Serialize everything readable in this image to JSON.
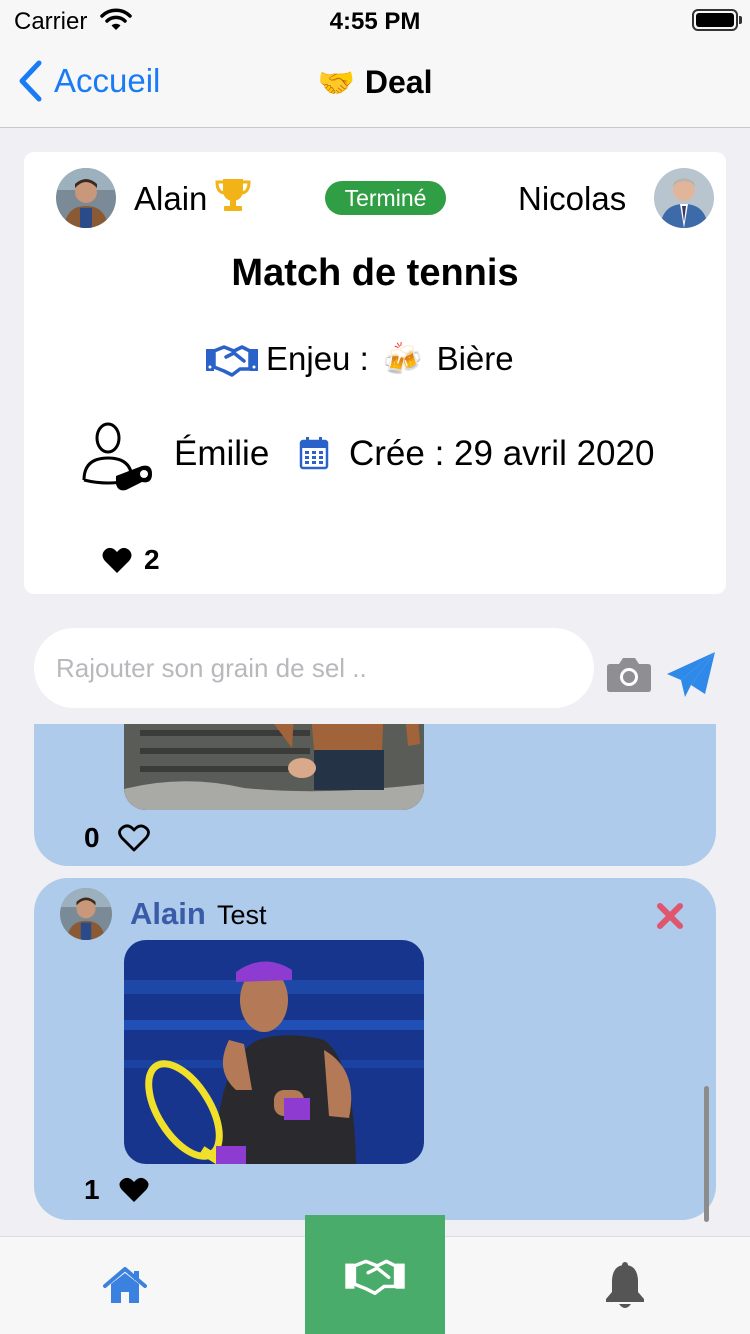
{
  "status_bar": {
    "carrier": "Carrier",
    "time": "4:55 PM"
  },
  "nav": {
    "back_label": "Accueil",
    "title_emoji": "🤝",
    "title": "Deal"
  },
  "deal": {
    "player1": {
      "name": "Alain"
    },
    "status": "Terminé",
    "player2": {
      "name": "Nicolas"
    },
    "title": "Match de tennis",
    "stake_label": "Enjeu :",
    "stake_emoji": "🍻",
    "stake_value": "Bière",
    "referee": "Émilie",
    "created": "Crée : 29 avril 2020",
    "likes": "2"
  },
  "comment_input": {
    "placeholder": "Rajouter son grain de sel .."
  },
  "posts": [
    {
      "likes": "0",
      "liked": false
    },
    {
      "author": "Alain",
      "text": "Test",
      "likes": "1",
      "liked": true
    }
  ],
  "colors": {
    "accent": "#1a7cf5",
    "status_green": "#2f9e44",
    "post_bg": "#aecbeb",
    "author": "#3a5ba8",
    "delete": "#e0566f",
    "tab_active": "#4aac6a",
    "tab_home": "#3b82e0"
  },
  "icons": {
    "back": "chevron-left-icon",
    "trophy": "trophy-icon",
    "handshake": "handshake-icon",
    "referee": "referee-icon",
    "calendar": "calendar-icon",
    "heart": "heart-icon",
    "camera": "camera-icon",
    "send": "paper-plane-icon",
    "delete": "close-icon",
    "home": "home-icon",
    "bell": "bell-icon"
  }
}
